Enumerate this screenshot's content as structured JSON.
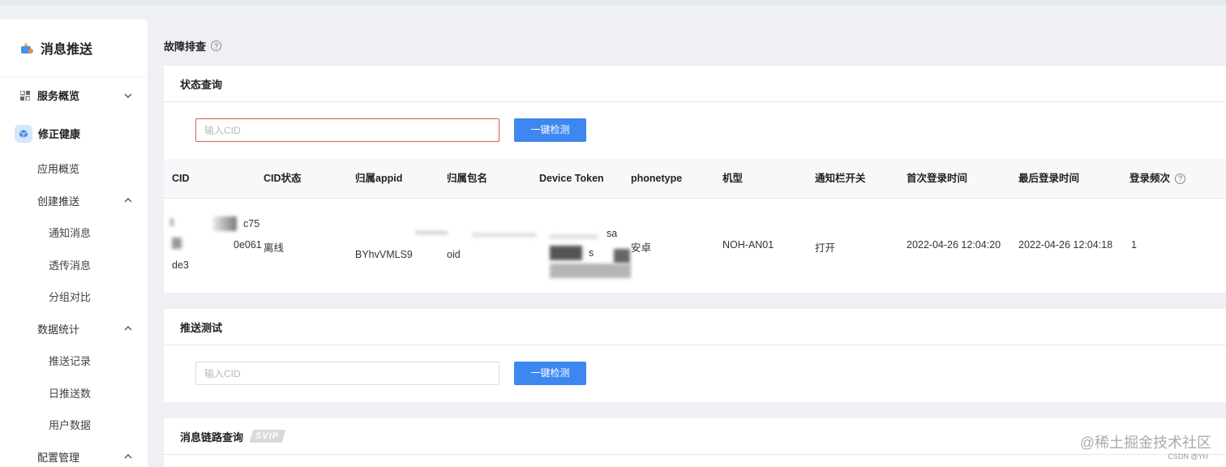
{
  "sidebar": {
    "brand": "消息推送",
    "groups": [
      {
        "label": "服务概览"
      },
      {
        "label": "修正健康"
      }
    ],
    "items": [
      {
        "label": "应用概览"
      },
      {
        "label": "创建推送"
      },
      {
        "label": "通知消息"
      },
      {
        "label": "透传消息"
      },
      {
        "label": "分组对比"
      },
      {
        "label": "数据统计"
      },
      {
        "label": "推送记录"
      },
      {
        "label": "日推送数"
      },
      {
        "label": "用户数据"
      },
      {
        "label": "配置管理"
      }
    ]
  },
  "page": {
    "title": "故障排查",
    "help": "?"
  },
  "status_query": {
    "title": "状态查询",
    "input_placeholder": "输入CID",
    "button": "一键检测",
    "columns": [
      "CID",
      "CID状态",
      "归属appid",
      "归属包名",
      "Device Token",
      "phonetype",
      "机型",
      "通知栏开关",
      "首次登录时间",
      "最后登录时间",
      "登录频次"
    ],
    "row": {
      "cid_line1": "c75",
      "cid_line2": "0e061",
      "cid_line3": "de3",
      "status": "离线",
      "appid": "BYhvVMLS9",
      "package": "oid",
      "token_fragment_1": "sa",
      "token_fragment_2": "s",
      "phonetype": "安卓",
      "model": "NOH-AN01",
      "notify_switch": "打开",
      "first_login": "2022-04-26 12:04:20",
      "last_login": "2022-04-26 12:04:18",
      "login_count": "1"
    }
  },
  "push_test": {
    "title": "推送测试",
    "input_placeholder": "输入CID",
    "button": "一键检测"
  },
  "chain_query": {
    "title": "消息链路查询",
    "badge": "SVIP"
  },
  "watermark": "@稀土掘金技术社区",
  "csdn": "CSDN @YH"
}
